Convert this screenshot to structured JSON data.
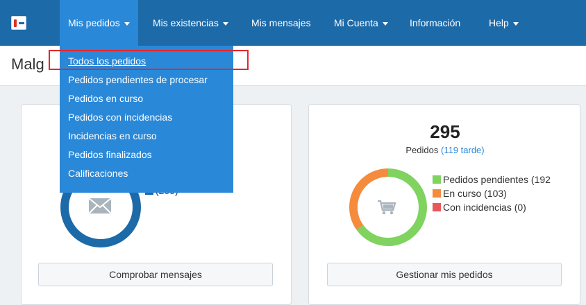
{
  "nav": {
    "items": [
      {
        "label": "Mis pedidos",
        "dropdown": true
      },
      {
        "label": "Mis existencias",
        "dropdown": true
      },
      {
        "label": "Mis mensajes",
        "dropdown": false
      },
      {
        "label": "Mi Cuenta",
        "dropdown": true
      },
      {
        "label": "Información",
        "dropdown": false
      },
      {
        "label": "Help",
        "dropdown": true
      }
    ]
  },
  "page": {
    "title": "Malg"
  },
  "dropdown": {
    "items": [
      "Todos los pedidos",
      "Pedidos pendientes de procesar",
      "Pedidos en curso",
      "Pedidos con incidencias",
      "Incidencias en curso",
      "Pedidos finalizados",
      "Calificaciones"
    ]
  },
  "messages_card": {
    "legend_partial": "(209)",
    "button": "Comprobar mensajes",
    "icon": "envelope-icon"
  },
  "orders_card": {
    "total": "295",
    "subtitle": "Pedidos",
    "late": "(119 tarde)",
    "legend": [
      {
        "label": "Pedidos pendientes (192",
        "color": "#7fd35e"
      },
      {
        "label": "En curso (103)",
        "color": "#f58b3d"
      },
      {
        "label": "Con incidencias (0)",
        "color": "#e8575a"
      }
    ],
    "button": "Gestionar mis pedidos",
    "icon": "cart-icon",
    "donut": {
      "green": 192,
      "orange": 103,
      "red": 0
    }
  },
  "colors": {
    "nav_bg": "#1d6aa8",
    "dropdown_bg": "#2a88d8",
    "highlight": "#e3262d",
    "donut_blue": "#1d6aa8"
  }
}
